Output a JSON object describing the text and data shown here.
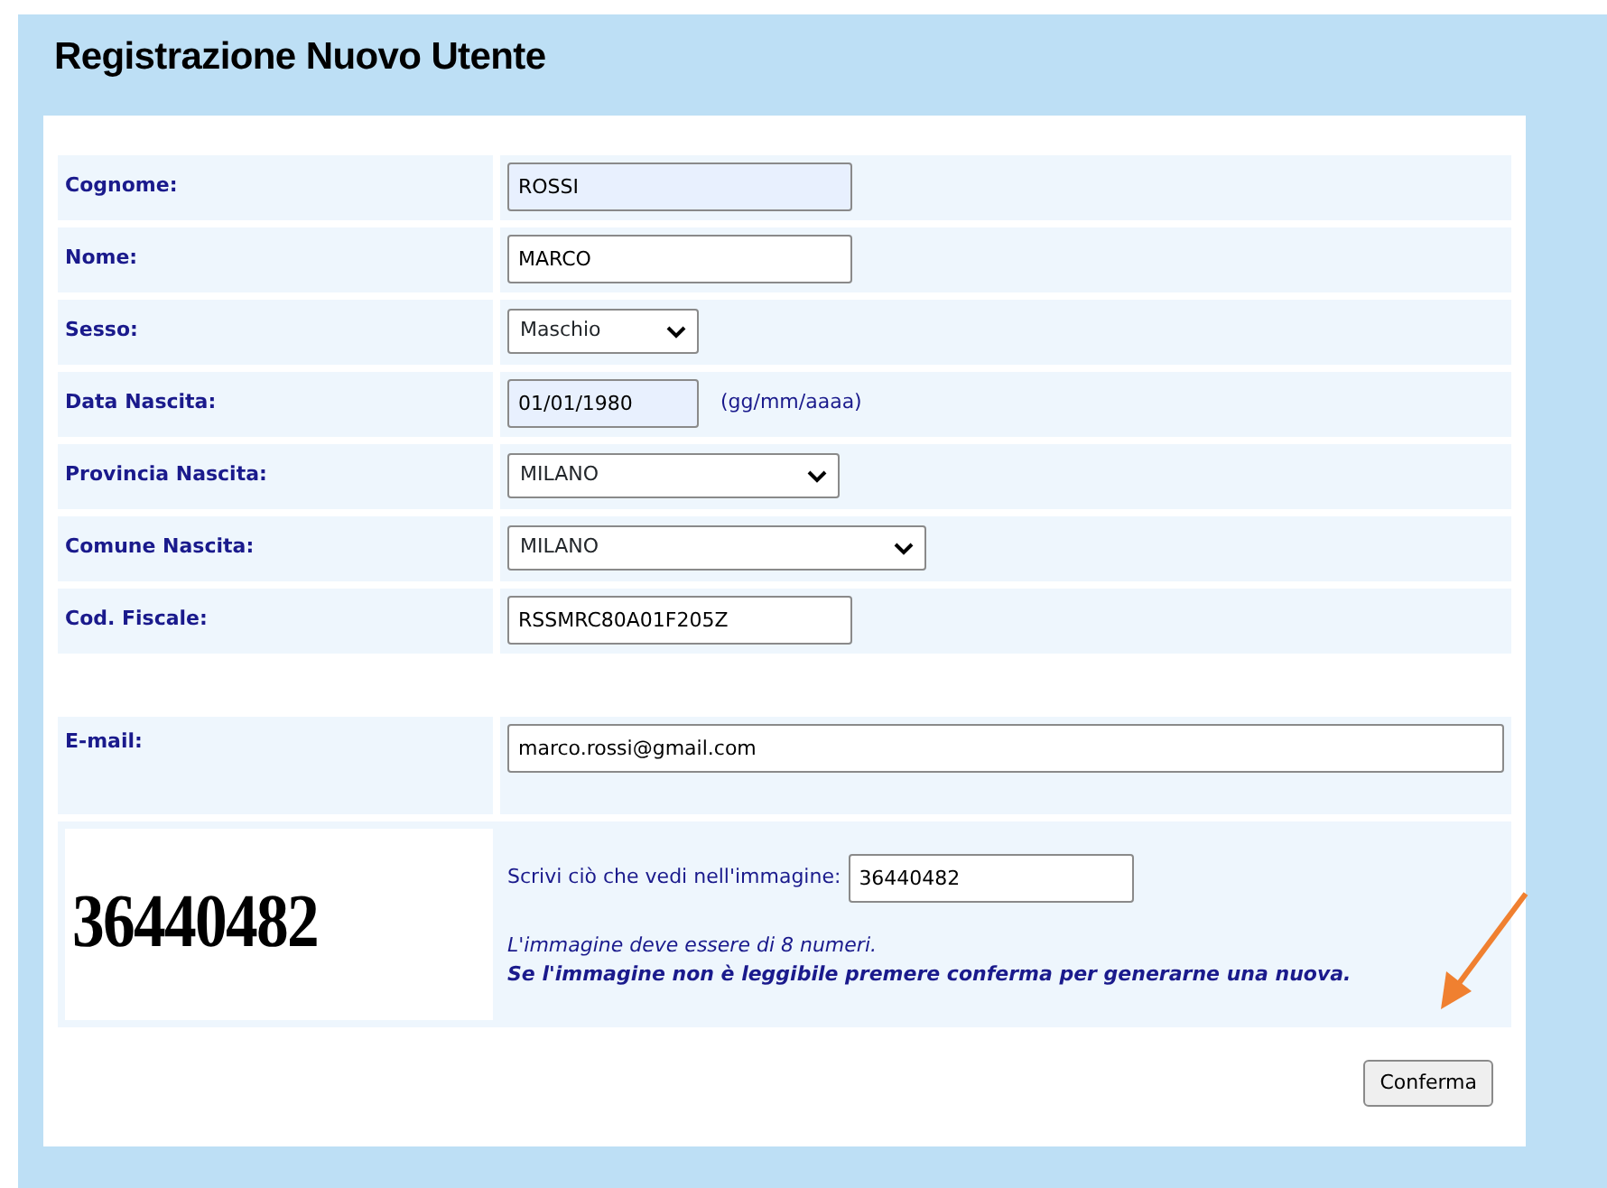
{
  "title": "Registrazione Nuovo Utente",
  "fields": [
    {
      "kind": "text",
      "label": "Cognome:",
      "value": "ROSSI",
      "readonly": true
    },
    {
      "kind": "text",
      "label": "Nome:",
      "value": "MARCO",
      "readonly": false
    },
    {
      "kind": "select",
      "label": "Sesso:",
      "value": "Maschio"
    },
    {
      "kind": "text",
      "label": "Data Nascita:",
      "value": "01/01/1980",
      "readonly": true,
      "hint": "(gg/mm/aaaa)"
    },
    {
      "kind": "select",
      "label": "Provincia Nascita:",
      "value": "MILANO"
    },
    {
      "kind": "select",
      "label": "Comune Nascita:",
      "value": "MILANO"
    },
    {
      "kind": "text",
      "label": "Cod. Fiscale:",
      "value": "RSSMRC80A01F205Z",
      "readonly": false
    },
    {
      "kind": "spacer"
    },
    {
      "kind": "email",
      "label": "E-mail:",
      "value": "marco.rossi@gmail.com",
      "readonly": false
    }
  ],
  "captcha": {
    "image_text": "36440482",
    "prompt": "Scrivi ciò che vedi nell'immagine:",
    "value": "36440482",
    "note": "L'immagine deve essere di 8 numeri.",
    "warning": "Se l'immagine non è leggibile premere conferma per generarne una nuova."
  },
  "submit": "Conferma"
}
